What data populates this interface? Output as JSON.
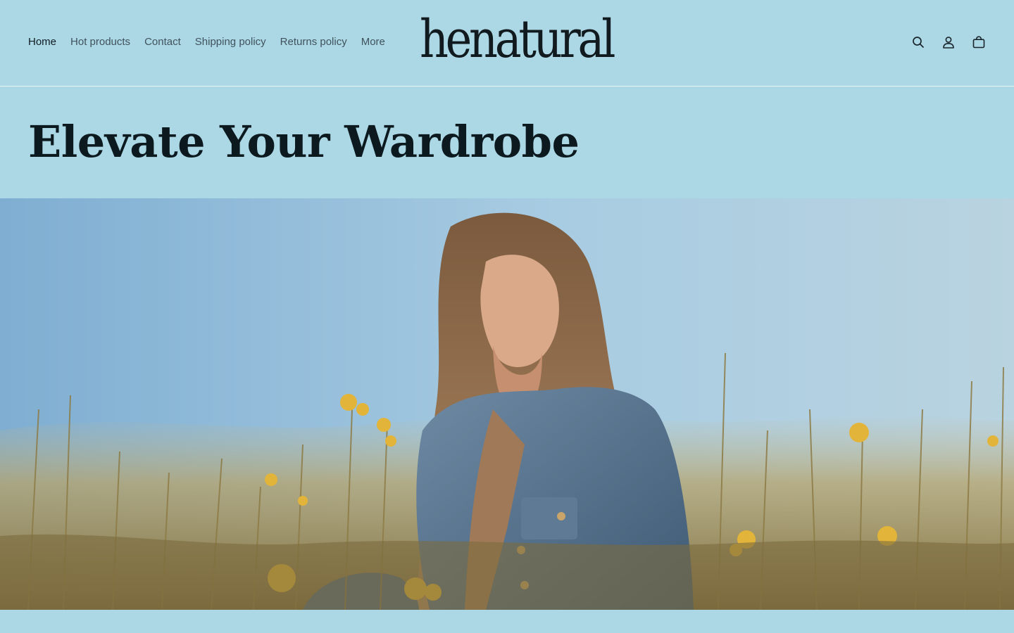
{
  "header": {
    "nav": [
      {
        "label": "Home",
        "active": true
      },
      {
        "label": "Hot products",
        "active": false
      },
      {
        "label": "Contact",
        "active": false
      },
      {
        "label": "Shipping policy",
        "active": false
      },
      {
        "label": "Returns policy",
        "active": false
      },
      {
        "label": "More",
        "active": false
      }
    ],
    "logo": "henatural",
    "icons": [
      "search-icon",
      "account-icon",
      "cart-icon"
    ]
  },
  "hero": {
    "title": "Elevate Your Wardrobe",
    "image": "woman-in-denim-jacket-wildflower-field"
  },
  "colors": {
    "background": "#acd8e6",
    "text_primary": "#0f1c22",
    "nav_text": "#40525c"
  }
}
